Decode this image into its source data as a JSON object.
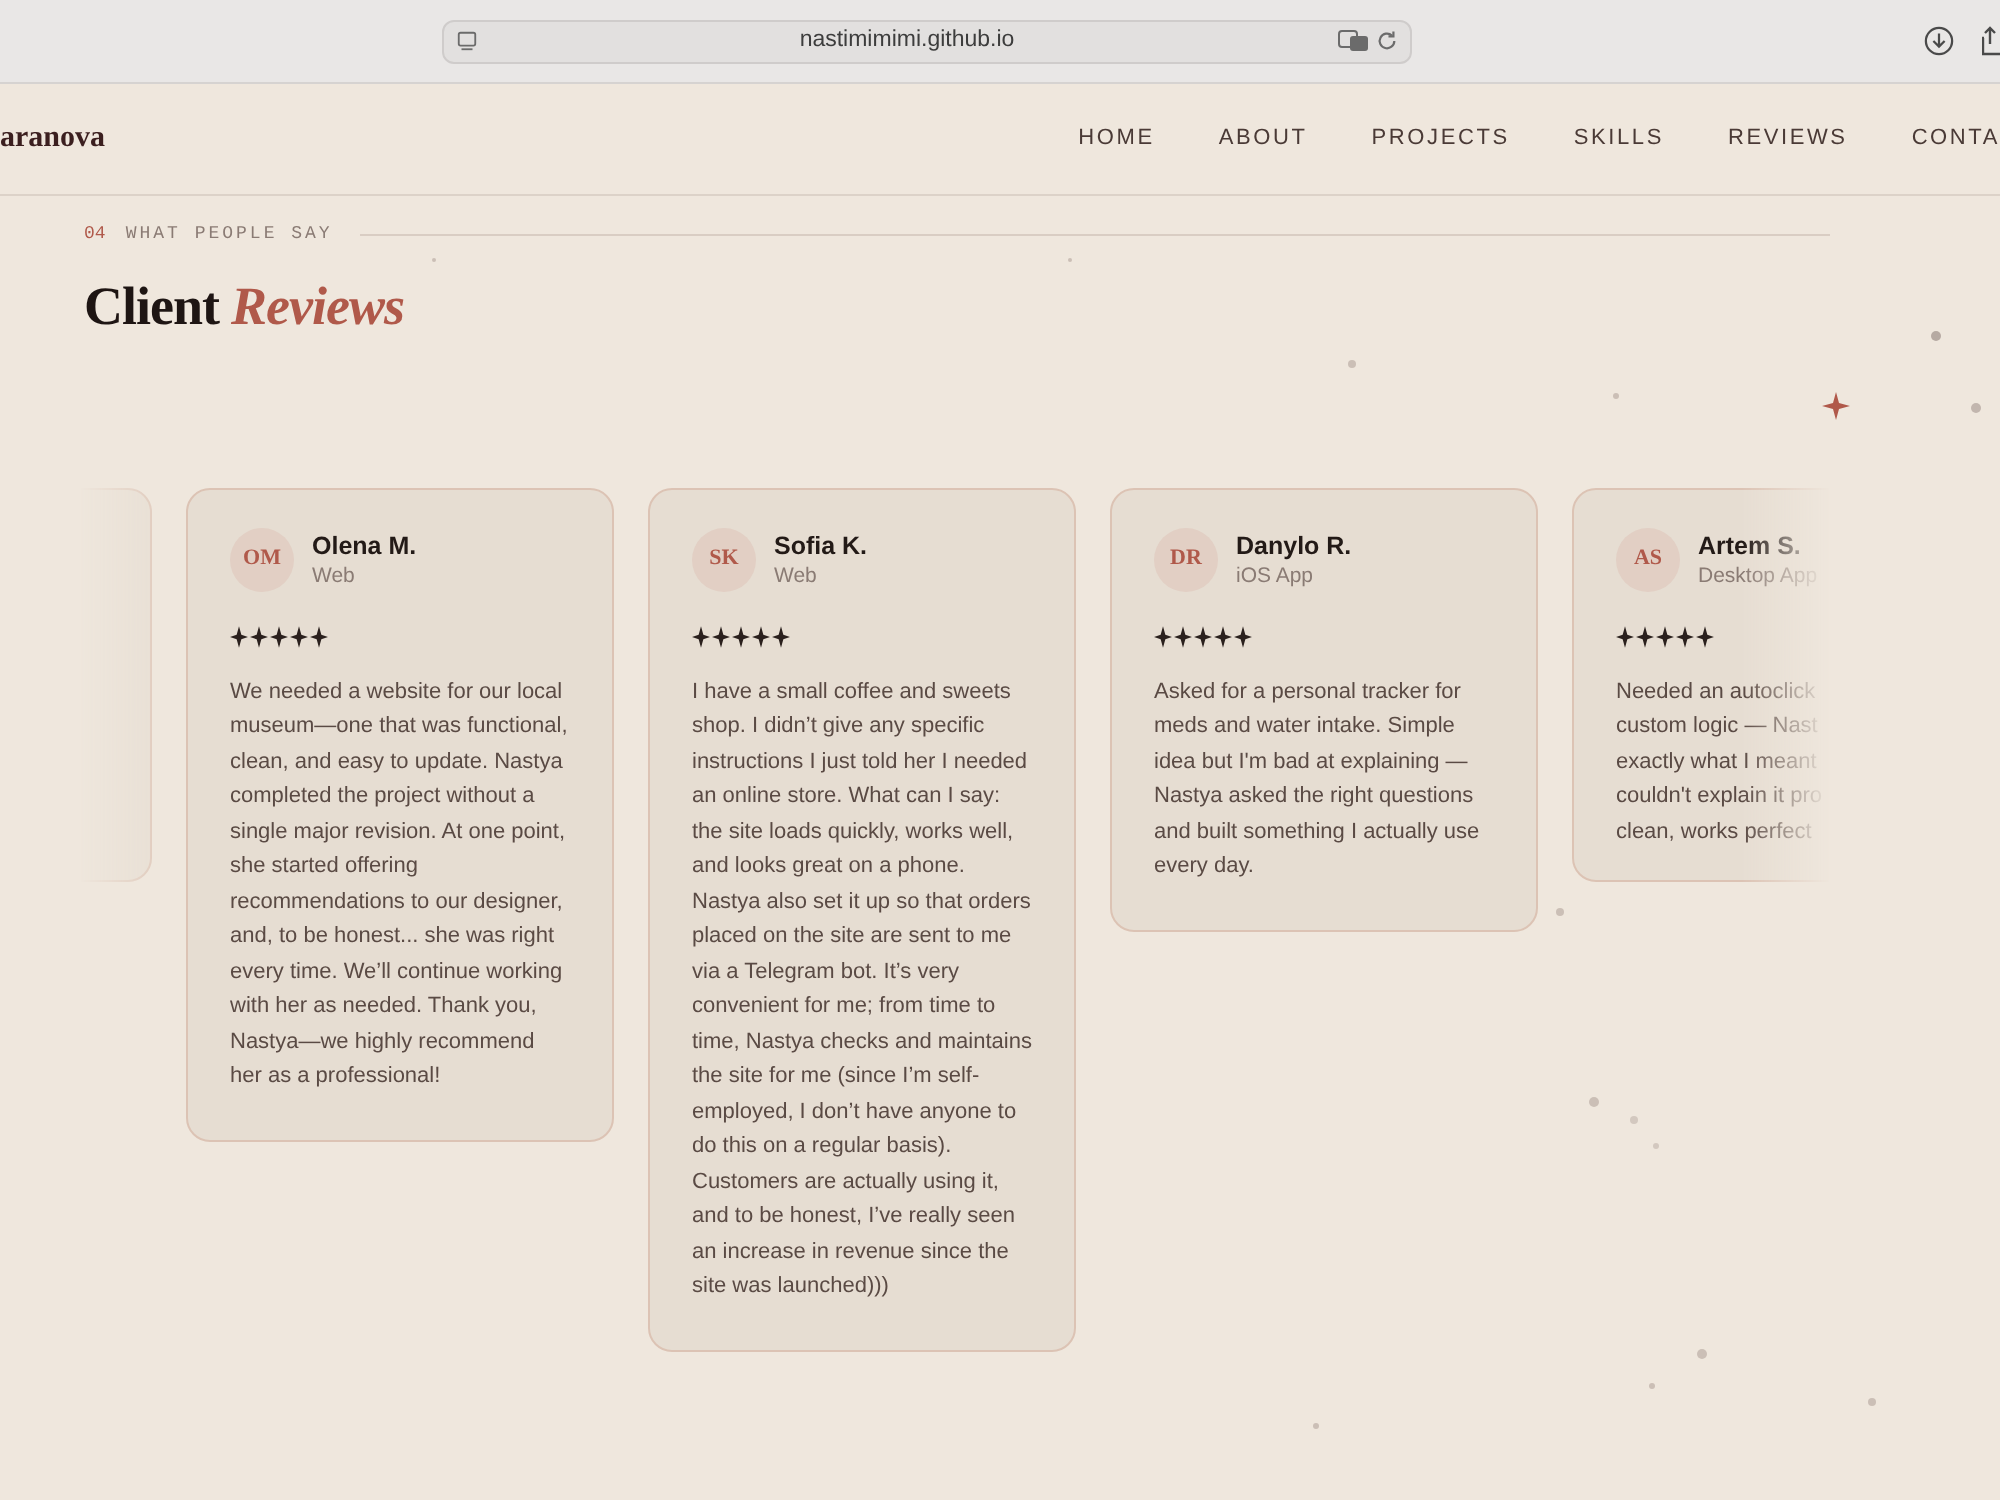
{
  "browser": {
    "url": "nastimimimi.github.io"
  },
  "header": {
    "logo": "aranova",
    "nav": [
      {
        "label": "HOME"
      },
      {
        "label": "ABOUT"
      },
      {
        "label": "PROJECTS"
      },
      {
        "label": "SKILLS"
      },
      {
        "label": "REVIEWS"
      },
      {
        "label": "CONTA"
      }
    ]
  },
  "section": {
    "number": "04",
    "eyebrow": "WHAT PEOPLE SAY",
    "title": "Client",
    "title_accent": "Reviews"
  },
  "reviews": [
    {
      "kind": "edge"
    },
    {
      "kind": "full",
      "initials": "OM",
      "name": "Olena M.",
      "role": "Web",
      "stars": 5,
      "text": "We needed a website for our local museum—one that was functional, clean, and easy to update. Nastya completed the project without a single major revision. At one point, she started offering recommendations to our designer, and, to be honest... she was right every time. We’ll continue working with her as needed. Thank you, Nastya—we highly recommend her as a professional!"
    },
    {
      "kind": "full",
      "initials": "SK",
      "name": "Sofia K.",
      "role": "Web",
      "stars": 5,
      "text": "I have a small coffee and sweets shop. I didn’t give any specific instructions I just told her I needed an online store. What can I say: the site loads quickly, works well, and looks great on a phone. Nastya also set it up so that orders placed on the site are sent to me via a Telegram bot. It’s very convenient for me; from time to time, Nastya checks and maintains the site for me (since I’m self-employed, I don’t have anyone to do this on a regular basis). Customers are actually using it, and to be honest, I’ve really seen an increase in revenue since the site was launched)))"
    },
    {
      "kind": "full",
      "initials": "DR",
      "name": "Danylo R.",
      "role": "iOS App",
      "stars": 5,
      "text": "Asked for a personal tracker for meds and water intake. Simple idea but I'm bad at explaining — Nastya asked the right questions and built something I actually use every day."
    },
    {
      "kind": "faded",
      "initials": "AS",
      "name": "Artem S.",
      "role": "Desktop App",
      "stars": 5,
      "lines": [
        "Needed an autoclick",
        "custom logic — Nast",
        "exactly what I meant",
        "couldn't explain it pro",
        "clean, works perfect"
      ]
    }
  ]
}
